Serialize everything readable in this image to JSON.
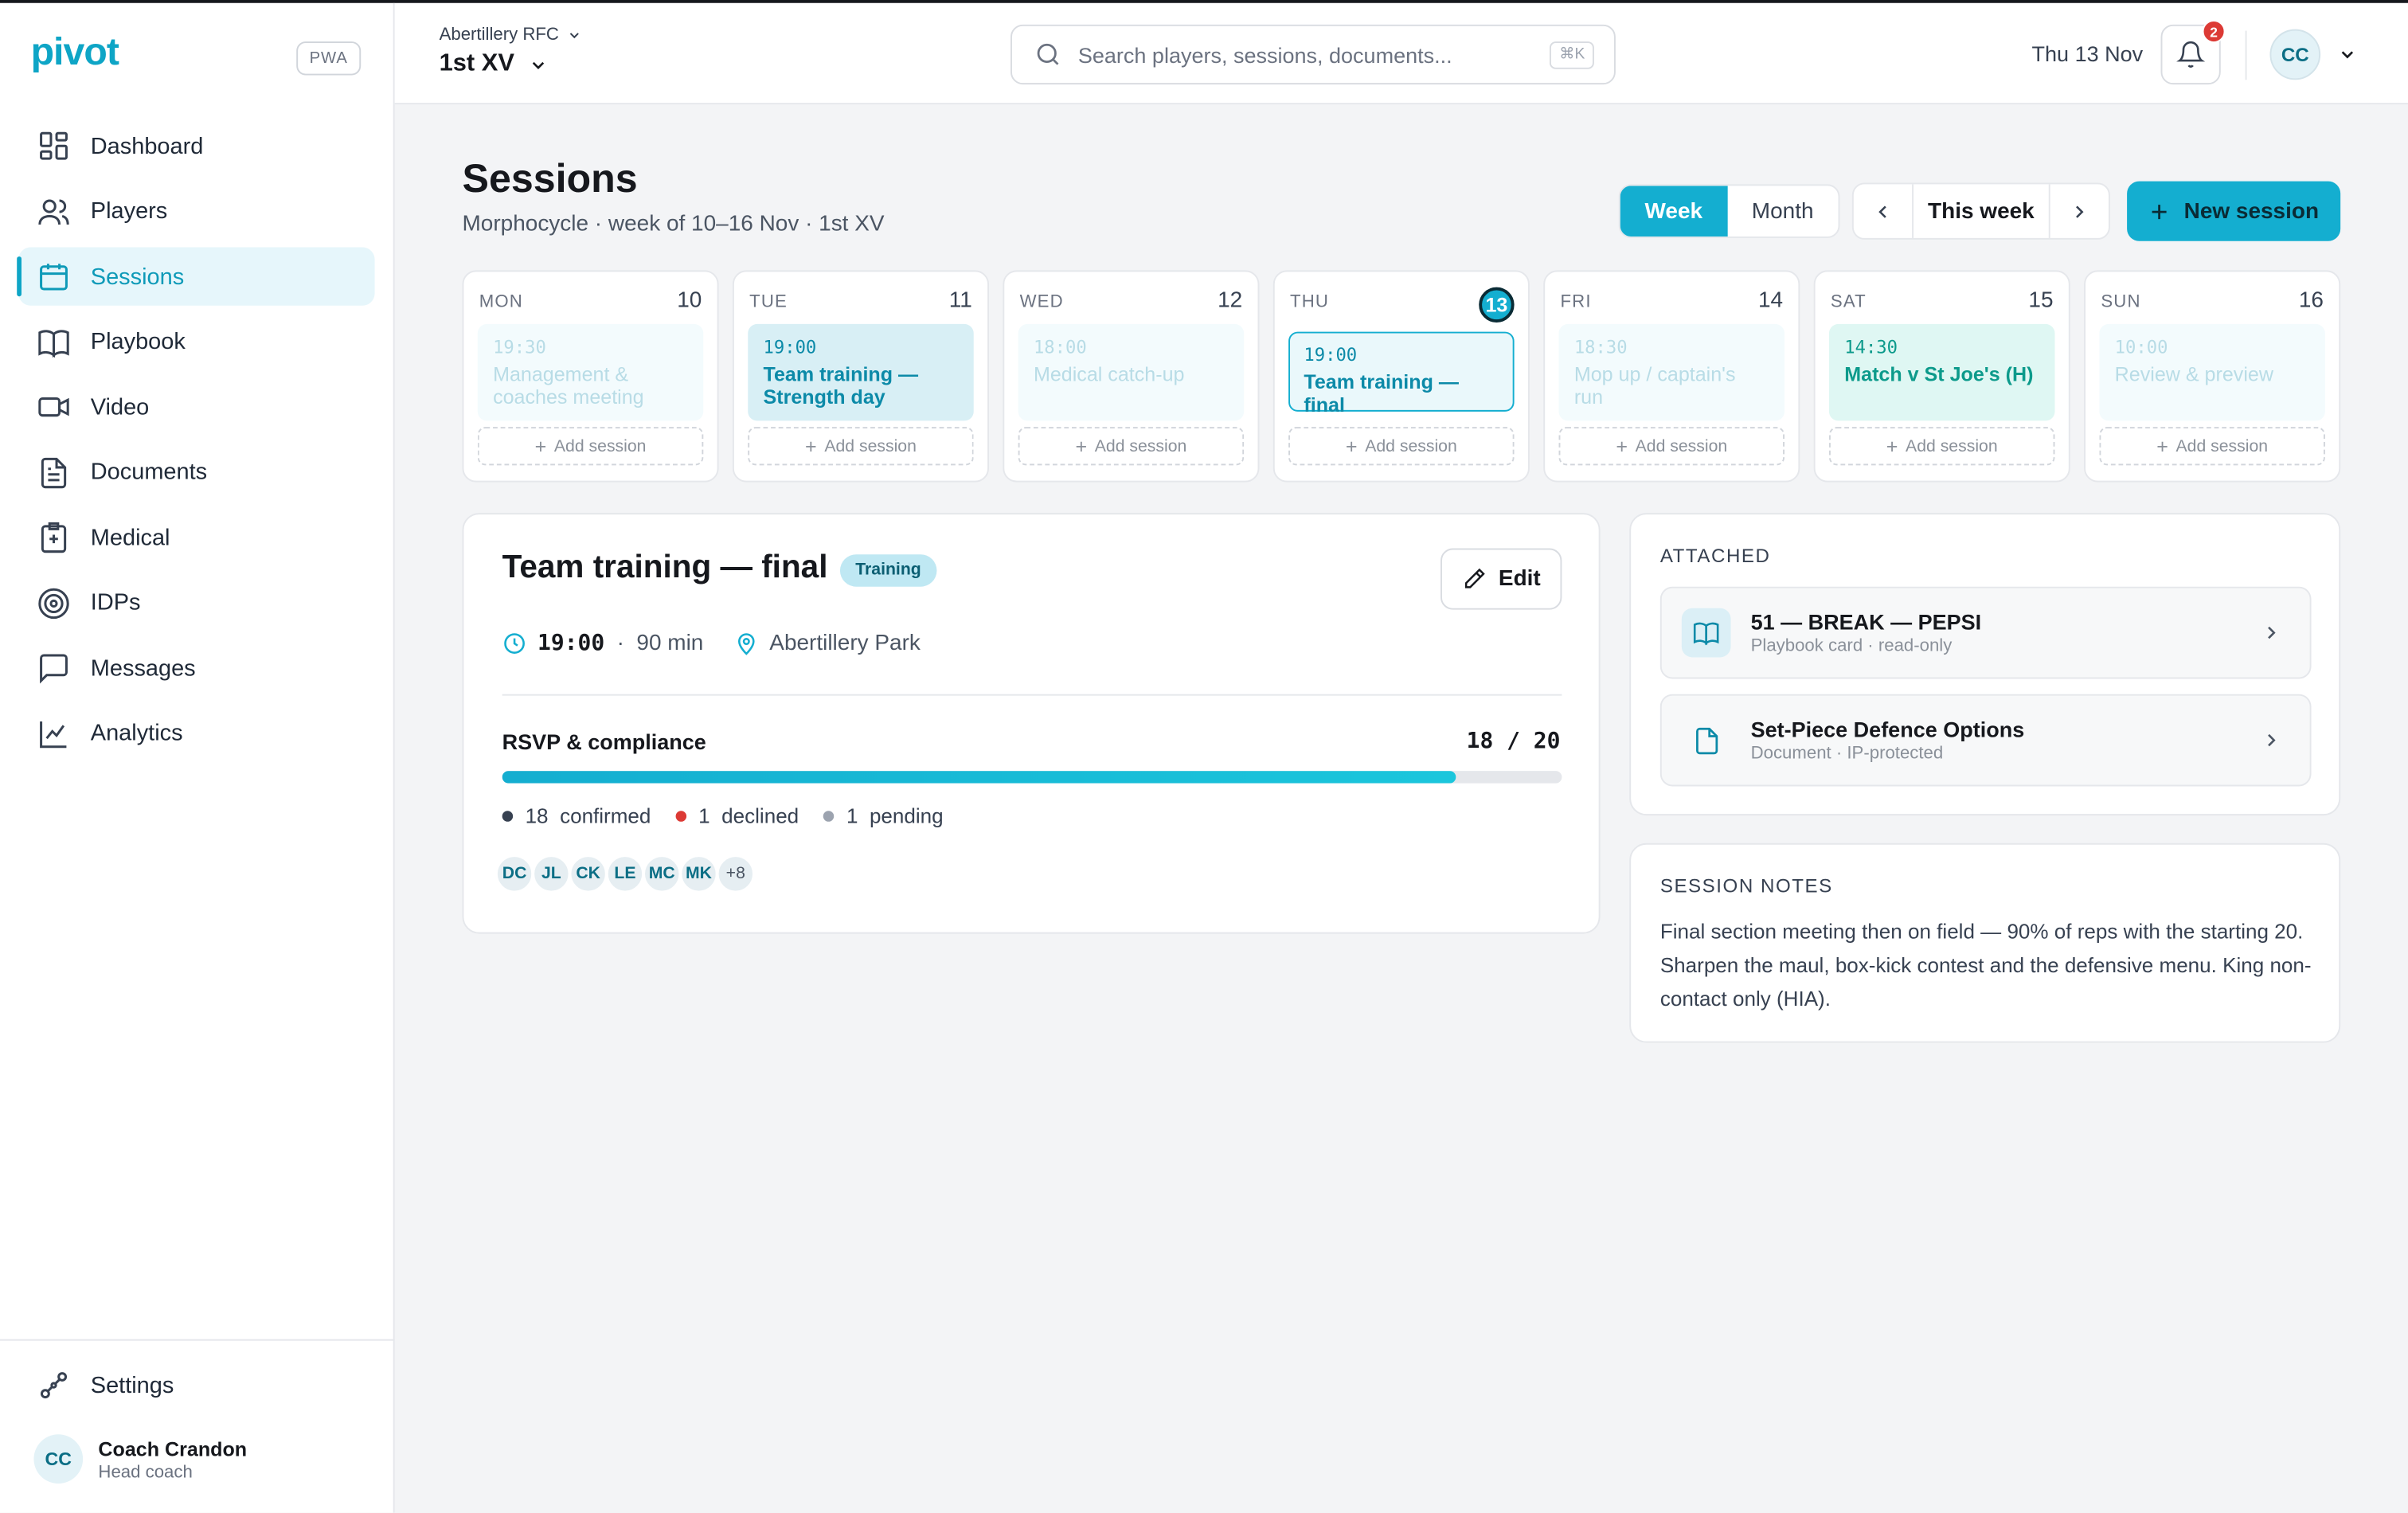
{
  "brand": {
    "logo": "pivot",
    "badge": "PWA"
  },
  "sidebar": {
    "items": [
      {
        "label": "Dashboard",
        "icon": "dashboard-icon"
      },
      {
        "label": "Players",
        "icon": "users-icon"
      },
      {
        "label": "Sessions",
        "icon": "calendar-icon",
        "active": true
      },
      {
        "label": "Playbook",
        "icon": "book-icon"
      },
      {
        "label": "Video",
        "icon": "video-icon"
      },
      {
        "label": "Documents",
        "icon": "document-icon"
      },
      {
        "label": "Medical",
        "icon": "medical-icon"
      },
      {
        "label": "IDPs",
        "icon": "target-icon"
      },
      {
        "label": "Messages",
        "icon": "message-icon"
      },
      {
        "label": "Analytics",
        "icon": "chart-icon"
      }
    ],
    "settings_label": "Settings",
    "user": {
      "initials": "CC",
      "name": "Coach Crandon",
      "role": "Head coach"
    }
  },
  "topbar": {
    "club": "Abertillery RFC",
    "team": "1st XV",
    "search_placeholder": "Search players, sessions, documents...",
    "search_shortcut": "⌘K",
    "date": "Thu 13 Nov",
    "notification_count": "2",
    "avatar_initials": "CC"
  },
  "page": {
    "title": "Sessions",
    "subtitle": "Morphocycle · week of 10–16 Nov · 1st XV",
    "view_week": "Week",
    "view_month": "Month",
    "range_label": "This week",
    "new_session_label": "New session"
  },
  "colors": {
    "accent": "#14aed0",
    "declined": "#dc3a35",
    "confirmed": "#374151",
    "pending": "#9ca3af"
  },
  "week": {
    "add_label": "Add session",
    "days": [
      {
        "name": "MON",
        "num": "10",
        "time": "19:30",
        "session": "Management & coaches meeting",
        "style": "faded"
      },
      {
        "name": "TUE",
        "num": "11",
        "time": "19:00",
        "session": "Team training — Strength day",
        "style": "tue"
      },
      {
        "name": "WED",
        "num": "12",
        "time": "18:00",
        "session": "Medical catch-up",
        "style": "faded"
      },
      {
        "name": "THU",
        "num": "13",
        "time": "19:00",
        "session": "Team training — final",
        "style": "thu",
        "today": true
      },
      {
        "name": "FRI",
        "num": "14",
        "time": "18:30",
        "session": "Mop up / captain's run",
        "style": "faded"
      },
      {
        "name": "SAT",
        "num": "15",
        "time": "14:30",
        "session": "Match v St Joe's (H)",
        "style": "sat"
      },
      {
        "name": "SUN",
        "num": "16",
        "time": "10:00",
        "session": "Review & preview",
        "style": "faded"
      }
    ]
  },
  "detail": {
    "title": "Team training — final",
    "tag": "Training",
    "edit_label": "Edit",
    "time": "19:00",
    "duration": "90 min",
    "location": "Abertillery Park",
    "rsvp_label": "RSVP & compliance",
    "rsvp_count": "18 / 20",
    "rsvp_confirmed": 18,
    "rsvp_total": 20,
    "rsvp_fraction": 0.9,
    "confirmed_count": "18",
    "confirmed_label": "confirmed",
    "declined_count": "1",
    "declined_label": "declined",
    "pending_count": "1",
    "pending_label": "pending",
    "avatars": [
      "DC",
      "JL",
      "CK",
      "LE",
      "MC",
      "MK",
      "+8"
    ]
  },
  "attached": {
    "heading": "ATTACHED",
    "items": [
      {
        "title": "51 — BREAK — PEPSI",
        "subtitle": "Playbook card · read-only",
        "icon": "book-icon"
      },
      {
        "title": "Set-Piece Defence Options",
        "subtitle": "Document · IP-protected",
        "icon": "document-icon"
      }
    ]
  },
  "notes": {
    "heading": "SESSION NOTES",
    "text": "Final section meeting then on field — 90% of reps with the starting 20. Sharpen the maul, box-kick contest and the defensive menu. King non-contact only (HIA)."
  }
}
